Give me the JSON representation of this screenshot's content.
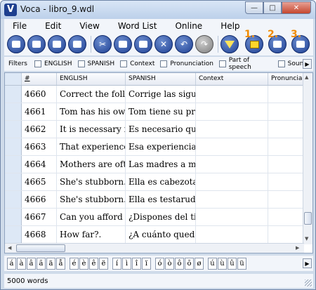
{
  "window": {
    "title": "Voca - libro_9.wdl",
    "logo_letter": "V"
  },
  "window_controls": {
    "minimize": "—",
    "maximize": "□",
    "close": "✕"
  },
  "menu": [
    "File",
    "Edit",
    "View",
    "Word List",
    "Online",
    "Help"
  ],
  "toolbar": {
    "buttons": [
      "new",
      "open",
      "save",
      "export",
      "cut",
      "copy",
      "paste",
      "delete",
      "undo",
      "redo",
      "filter"
    ],
    "numbered_buttons": [
      {
        "label": "1."
      },
      {
        "label": "2."
      },
      {
        "label": "3."
      }
    ]
  },
  "filters": {
    "label": "Filters",
    "options": [
      "ENGLISH",
      "SPANISH",
      "Context",
      "Pronunciation",
      "Part of speech",
      "Sound"
    ],
    "scroll_right": "▶"
  },
  "table": {
    "columns": [
      "",
      "#",
      "ENGLISH",
      "SPANISH",
      "Context",
      "Pronuncia"
    ],
    "rows": [
      {
        "id": "4660",
        "english": "Correct the follo",
        "spanish": "Corrige las sigui"
      },
      {
        "id": "4661",
        "english": "Tom has his own",
        "spanish": "Tom tiene su pro"
      },
      {
        "id": "4662",
        "english": "It is necessary fo",
        "spanish": "Es necesario que"
      },
      {
        "id": "4663",
        "english": "That experience",
        "spanish": "Esa experiencia"
      },
      {
        "id": "4664",
        "english": "Mothers are ofte",
        "spanish": "Las madres a me"
      },
      {
        "id": "4665",
        "english": "She's stubborn.",
        "spanish": "Ella es cabezota."
      },
      {
        "id": "4666",
        "english": "She's stubborn.",
        "spanish": "Ella es testaruda."
      },
      {
        "id": "4667",
        "english": "Can you afford t",
        "spanish": "¿Dispones del tie"
      },
      {
        "id": "4668",
        "english": "How far?.",
        "spanish": "¿A cuánto queda"
      }
    ]
  },
  "special_chars": {
    "groups": [
      [
        "á",
        "à",
        "â",
        "ã",
        "ä",
        "å"
      ],
      [
        "é",
        "è",
        "ê",
        "ë"
      ],
      [
        "í",
        "ì",
        "î",
        "ï"
      ],
      [
        "ó",
        "ò",
        "ô",
        "õ",
        "ø"
      ],
      [
        "ú",
        "ù",
        "û",
        "ü"
      ]
    ],
    "scroll_right": "▶"
  },
  "status": {
    "text": "5000 words"
  },
  "colors": {
    "accent": "#1c3e92",
    "highlight_numbers": "#f08a00",
    "funnel": "#ffe25a"
  }
}
